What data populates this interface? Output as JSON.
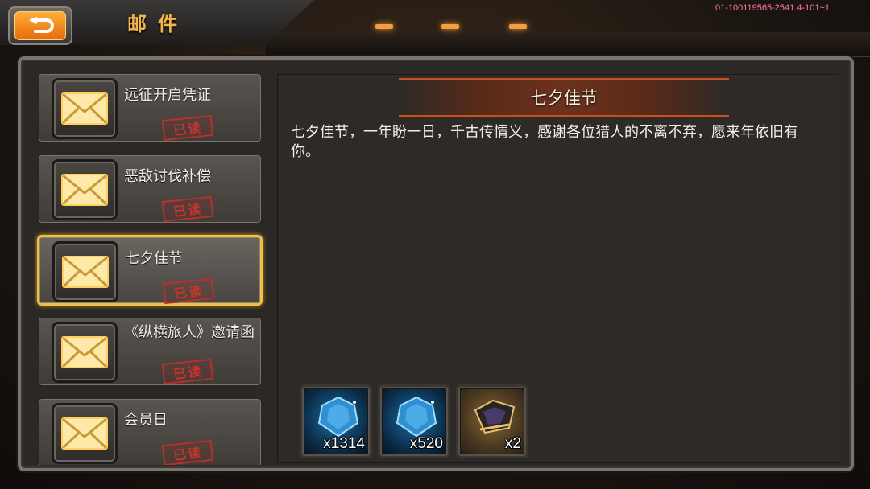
{
  "header": {
    "title": "邮件",
    "version": "01-100119565-2541.4-101~1",
    "back_icon": "return-arrow-icon"
  },
  "mail_list": [
    {
      "subject": "远征开启凭证",
      "status": "已读",
      "selected": false
    },
    {
      "subject": "恶敌讨伐补偿",
      "status": "已读",
      "selected": false
    },
    {
      "subject": "七夕佳节",
      "status": "已读",
      "selected": true
    },
    {
      "subject": "《纵横旅人》邀请函",
      "status": "已读",
      "selected": false
    },
    {
      "subject": "会员日",
      "status": "已读",
      "selected": false
    }
  ],
  "content": {
    "title": "七夕佳节",
    "body": "七夕佳节，一年盼一日，千古传情义，感谢各位猎人的不离不弃，愿来年依旧有你。"
  },
  "attachments": [
    {
      "icon": "blue-gem-icon",
      "count": "x1314"
    },
    {
      "icon": "blue-gem-icon",
      "count": "x520"
    },
    {
      "icon": "equipment-item-icon",
      "count": "x2"
    }
  ],
  "colors": {
    "accent": "#f3b44a",
    "selected_border": "#f0c040",
    "stamp": "#c8342c"
  }
}
